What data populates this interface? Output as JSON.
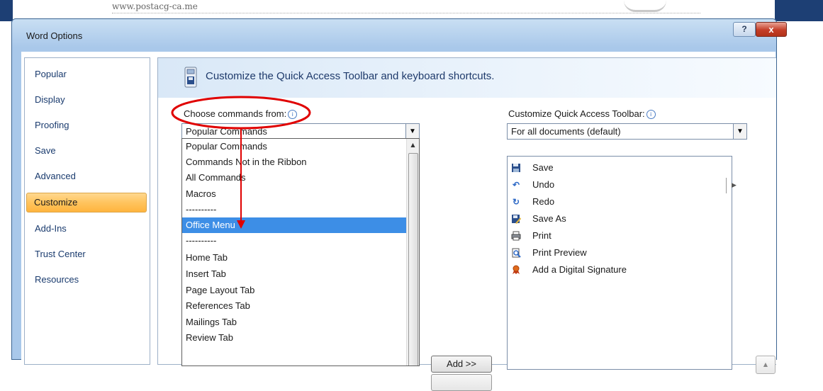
{
  "background": {
    "url_text": "www.postacg-ca.me"
  },
  "dialog": {
    "title": "Word Options",
    "help_label": "?",
    "close_label": "x"
  },
  "nav": {
    "items": [
      {
        "label": "Popular"
      },
      {
        "label": "Display"
      },
      {
        "label": "Proofing"
      },
      {
        "label": "Save"
      },
      {
        "label": "Advanced"
      },
      {
        "label": "Customize"
      },
      {
        "label": "Add-Ins"
      },
      {
        "label": "Trust Center"
      },
      {
        "label": "Resources"
      }
    ],
    "active": "Customize"
  },
  "header": {
    "text": "Customize the Quick Access Toolbar and keyboard shortcuts."
  },
  "choose": {
    "label": "Choose commands from:",
    "value": "Popular Commands",
    "dropdown_items": [
      "Popular Commands",
      "Commands Not in the Ribbon",
      "All Commands",
      "Macros",
      "----------",
      "Office Menu",
      "----------",
      "Home Tab",
      "Insert Tab",
      "Page Layout Tab",
      "References Tab",
      "Mailings Tab",
      "Review Tab"
    ],
    "selected_item": "Office Menu"
  },
  "customize_qat": {
    "label": "Customize Quick Access Toolbar:",
    "value": "For all documents (default)",
    "items": [
      {
        "label": "Save",
        "icon": "save-icon"
      },
      {
        "label": "Undo",
        "icon": "undo-icon"
      },
      {
        "label": "Redo",
        "icon": "redo-icon"
      },
      {
        "label": "Save As",
        "icon": "save-as-icon"
      },
      {
        "label": "Print",
        "icon": "print-icon"
      },
      {
        "label": "Print Preview",
        "icon": "print-preview-icon"
      },
      {
        "label": "Add a Digital Signature",
        "icon": "digital-signature-icon"
      }
    ]
  },
  "buttons": {
    "add": "Add >>"
  },
  "colors": {
    "annotation": "#e00000",
    "selection": "#3d8ee6",
    "nav_active": "#ffc45e"
  }
}
